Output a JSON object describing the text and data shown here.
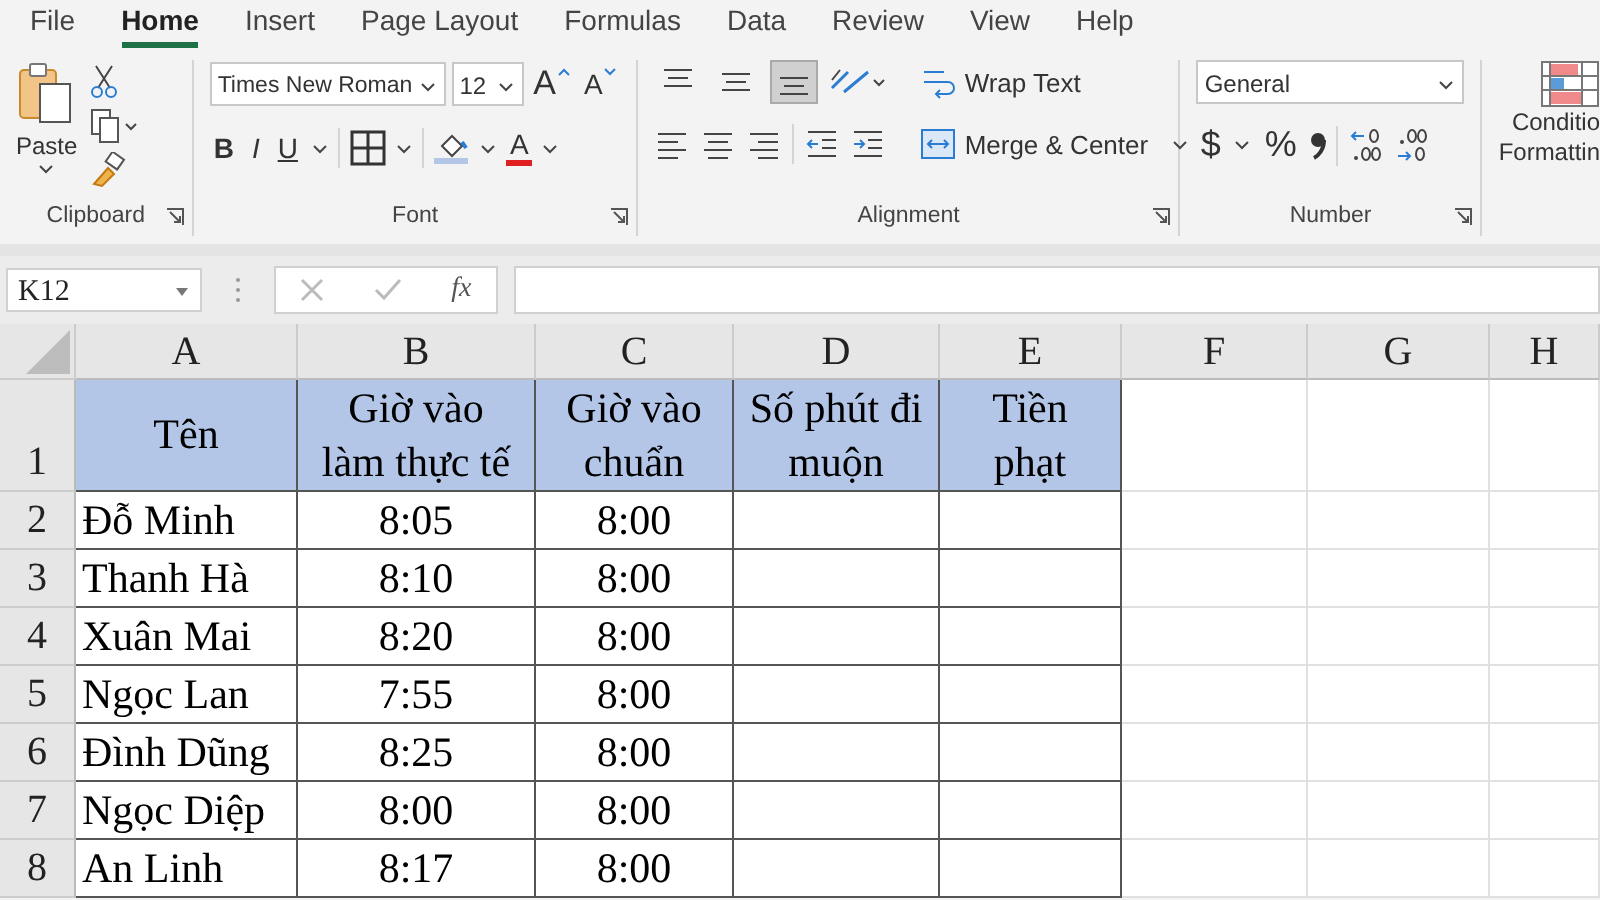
{
  "menu": {
    "tabs": [
      {
        "label": "File",
        "selected": false
      },
      {
        "label": "Home",
        "selected": true
      },
      {
        "label": "Insert",
        "selected": false
      },
      {
        "label": "Page Layout",
        "selected": false
      },
      {
        "label": "Formulas",
        "selected": false
      },
      {
        "label": "Data",
        "selected": false
      },
      {
        "label": "Review",
        "selected": false
      },
      {
        "label": "View",
        "selected": false
      },
      {
        "label": "Help",
        "selected": false
      }
    ]
  },
  "ribbon": {
    "groups": [
      {
        "kind": "clipboard",
        "label": "Clipboard",
        "paste": "Paste"
      },
      {
        "kind": "font",
        "label": "Font",
        "font_name": "Times New Roman",
        "font_size": "12",
        "grow": "A",
        "shrink": "A",
        "bold": "B",
        "italic": "I",
        "underline": "U",
        "font_color": "A"
      },
      {
        "kind": "alignment",
        "label": "Alignment",
        "vertical_align": [
          {
            "selected": false
          },
          {
            "selected": false
          },
          {
            "selected": true
          }
        ],
        "wrap": "Wrap Text",
        "merge": "Merge & Center"
      },
      {
        "kind": "number",
        "label": "Number",
        "format": "General",
        "currency": "$",
        "percent": "%"
      },
      {
        "kind": "styles",
        "line_1": "Conditio",
        "line_2": "Formattin"
      }
    ]
  },
  "formula_bar": {
    "name_box": "K12",
    "fx": "fx"
  },
  "sheet": {
    "columns": [
      "A",
      "B",
      "C",
      "D",
      "E",
      "F",
      "G",
      "H"
    ],
    "rows": [
      {
        "number": "1",
        "kind": "header",
        "cells": [
          "Tên",
          "Giờ vào\nlàm thực tế",
          "Giờ vào\nchuẩn",
          "Số phút đi\nmuộn",
          "Tiền\nphạt"
        ]
      },
      {
        "number": "2",
        "kind": "data",
        "cells": [
          "Đỗ Minh",
          "8:05",
          "8:00"
        ]
      },
      {
        "number": "3",
        "kind": "data",
        "cells": [
          "Thanh Hà",
          "8:10",
          "8:00"
        ]
      },
      {
        "number": "4",
        "kind": "data",
        "cells": [
          "Xuân Mai",
          "8:20",
          "8:00"
        ]
      },
      {
        "number": "5",
        "kind": "data",
        "cells": [
          "Ngọc Lan",
          "7:55",
          "8:00"
        ]
      },
      {
        "number": "6",
        "kind": "data",
        "cells": [
          "Đình Dũng",
          "8:25",
          "8:00"
        ]
      },
      {
        "number": "7",
        "kind": "data",
        "cells": [
          "Ngọc Diệp",
          "8:00",
          "8:00"
        ]
      },
      {
        "number": "8",
        "kind": "data",
        "cells": [
          "An Linh",
          "8:17",
          "8:00"
        ]
      }
    ]
  }
}
